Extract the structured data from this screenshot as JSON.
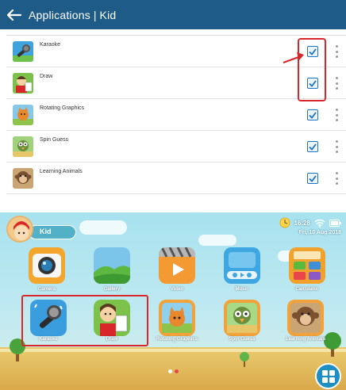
{
  "header": {
    "title_part1": "Applications",
    "separator": "|",
    "title_part2": "Kid",
    "bar_color": "#1e5b86"
  },
  "app_list": [
    {
      "name": "Karaoke",
      "checked": true,
      "icon": "karaoke-microphone-icon"
    },
    {
      "name": "Draw",
      "checked": true,
      "icon": "draw-girl-icon"
    },
    {
      "name": "Rotating Graphics",
      "checked": true,
      "icon": "rotating-graphics-fox-icon"
    },
    {
      "name": "Spin Guess",
      "checked": true,
      "icon": "spin-guess-bird-icon"
    },
    {
      "name": "Learning Animals",
      "checked": true,
      "icon": "learning-animals-monkey-icon"
    }
  ],
  "launcher": {
    "profile_name": "Kid",
    "time": "16:28",
    "date": "Fri, 10 Aug 2018",
    "apps_row1": [
      {
        "label": "Camera",
        "icon": "camera-icon"
      },
      {
        "label": "Gallery",
        "icon": "gallery-icon"
      },
      {
        "label": "Video",
        "icon": "video-clapper-icon"
      },
      {
        "label": "Music",
        "icon": "music-player-icon"
      },
      {
        "label": "Calculator",
        "icon": "calculator-icon"
      }
    ],
    "apps_row2": [
      {
        "label": "Karaoke",
        "icon": "karaoke-microphone-icon"
      },
      {
        "label": "Draw",
        "icon": "draw-girl-icon"
      },
      {
        "label": "Rotating Graphics",
        "icon": "rotating-graphics-fox-icon"
      },
      {
        "label": "Spin Guess",
        "icon": "spin-guess-bird-icon"
      },
      {
        "label": "Learning Animals",
        "icon": "learning-animals-monkey-icon"
      }
    ],
    "accent_color": "#1e8fc2",
    "annotation_color": "#d8262a"
  }
}
